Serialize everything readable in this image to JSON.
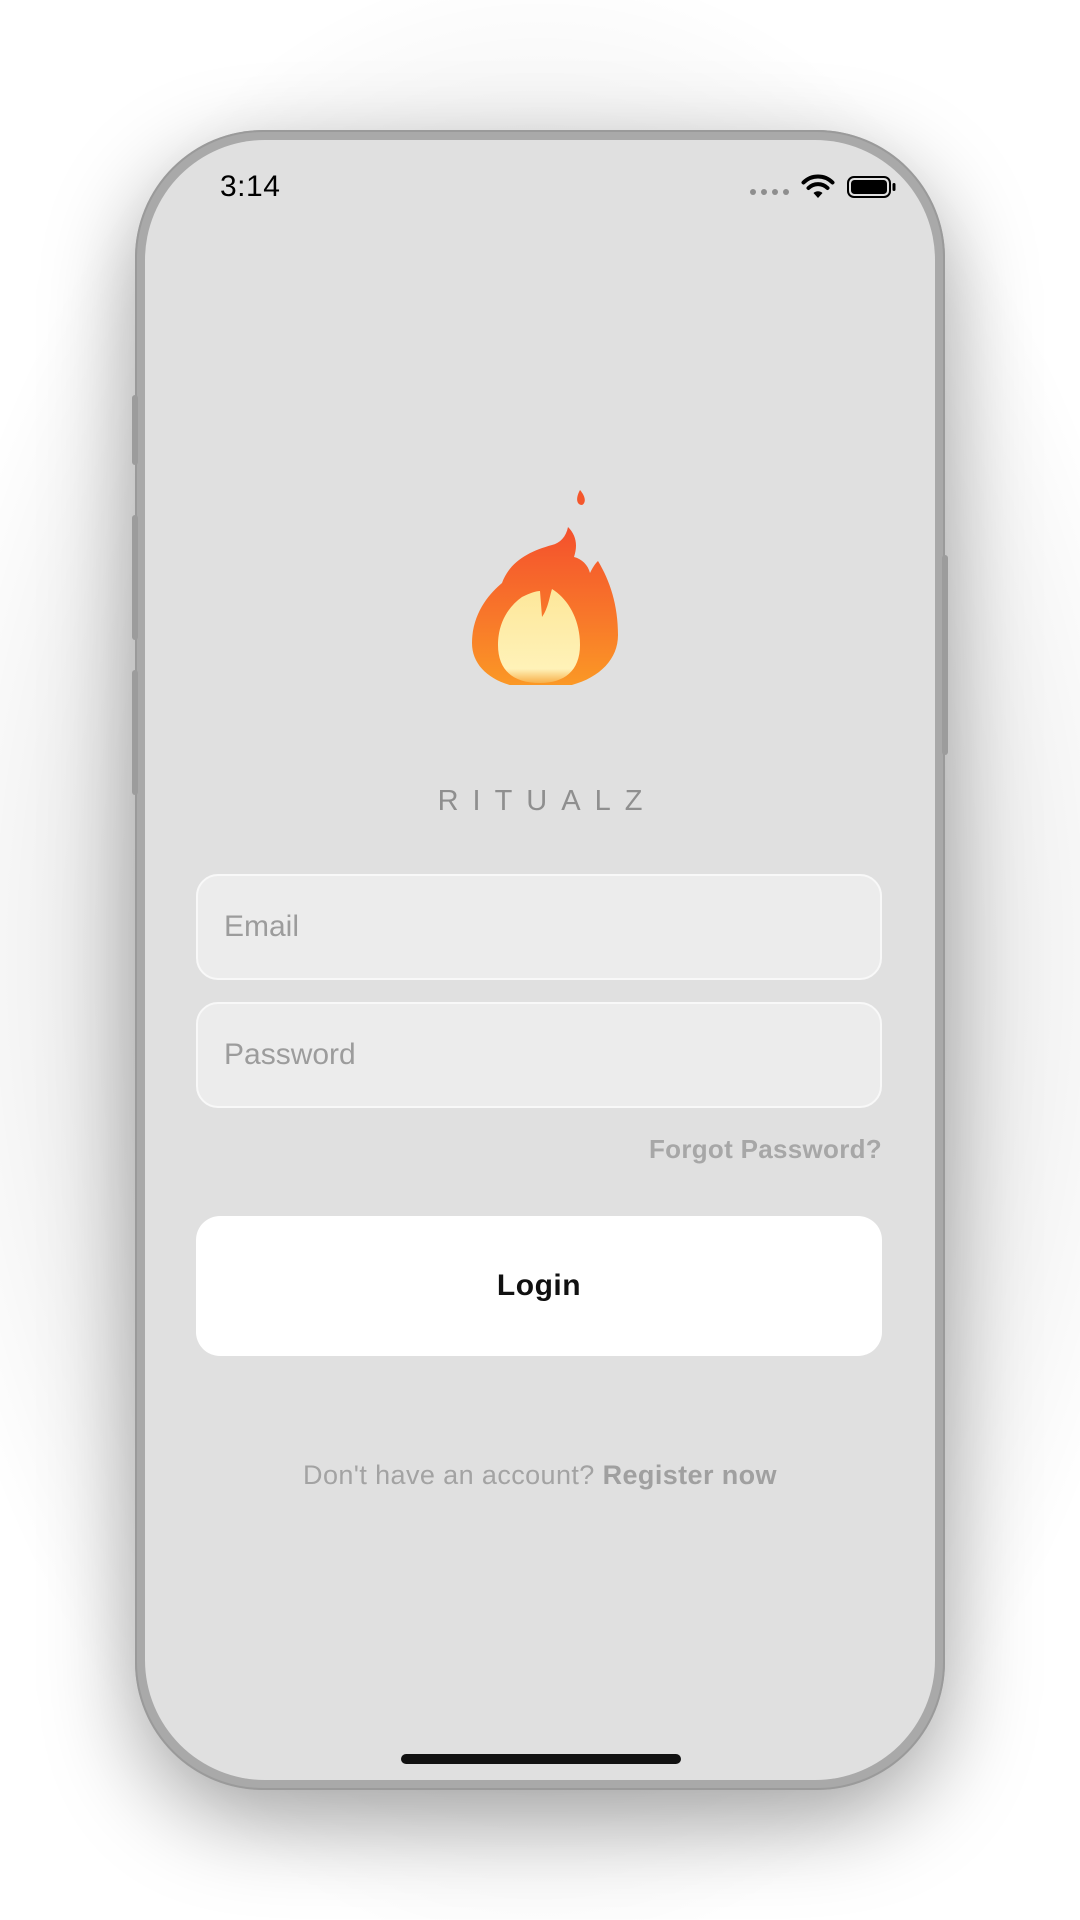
{
  "status_bar": {
    "time": "3:14",
    "icons": [
      "signal-dots-icon",
      "wifi-icon",
      "battery-icon"
    ]
  },
  "app": {
    "logo_icon": "fire-icon",
    "name": "RITUALZ"
  },
  "form": {
    "email_placeholder": "Email",
    "password_placeholder": "Password",
    "forgot_password_label": "Forgot Password?",
    "login_label": "Login"
  },
  "footer": {
    "prompt": "Don't have an account?",
    "register_label": "Register now"
  },
  "colors": {
    "screen_background": "#e0e0e0",
    "field_background": "#ececec",
    "button_background": "#ffffff",
    "muted_text": "#a3a3a3",
    "flame_outer": "#f46a2a",
    "flame_inner": "#fde79a"
  }
}
